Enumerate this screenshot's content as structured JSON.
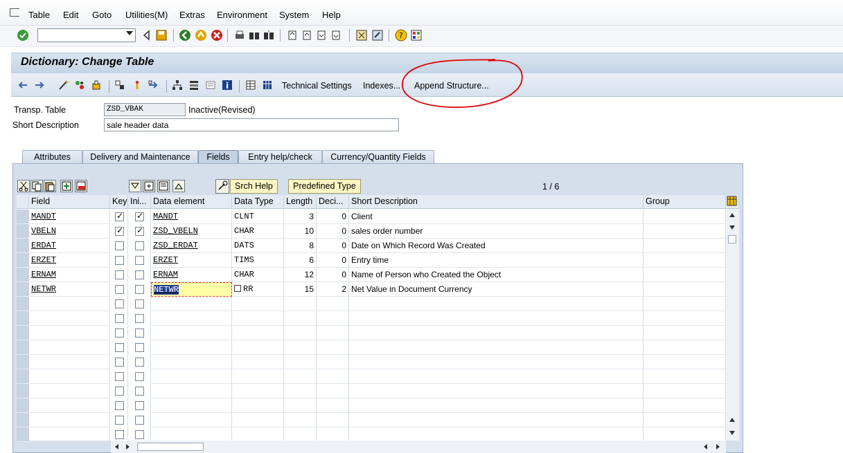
{
  "menu": [
    "Table",
    "Edit",
    "Goto",
    "Utilities(M)",
    "Extras",
    "Environment",
    "System",
    "Help"
  ],
  "title": "Dictionary: Change Table",
  "app_toolbar": {
    "technical_settings": "Technical Settings",
    "indexes": "Indexes...",
    "append_structure": "Append Structure..."
  },
  "header": {
    "table_label": "Transp. Table",
    "table_value": "ZSD_VBAK",
    "status": "Inactive(Revised)",
    "desc_label": "Short Description",
    "desc_value": "sale header data"
  },
  "tabs": [
    "Attributes",
    "Delivery and Maintenance",
    "Fields",
    "Entry help/check",
    "Currency/Quantity Fields"
  ],
  "buttons": {
    "srch_help": "Srch Help",
    "predefined_type": "Predefined Type",
    "page": "1 / 6"
  },
  "columns": [
    "Field",
    "Key",
    "Ini...",
    "Data element",
    "Data Type",
    "Length",
    "Deci...",
    "Short Description",
    "Group"
  ],
  "rows": [
    {
      "field": "MANDT",
      "key": true,
      "init": true,
      "element": "MANDT",
      "type": "CLNT",
      "length": "3",
      "dec": "0",
      "desc": "Client"
    },
    {
      "field": "VBELN",
      "key": true,
      "init": true,
      "element": "ZSD_VBELN",
      "type": "CHAR",
      "length": "10",
      "dec": "0",
      "desc": "sales order number"
    },
    {
      "field": "ERDAT",
      "key": false,
      "init": false,
      "element": "ZSD_ERDAT",
      "type": "DATS",
      "length": "8",
      "dec": "0",
      "desc": "Date on Which Record Was Created"
    },
    {
      "field": "ERZET",
      "key": false,
      "init": false,
      "element": "ERZET",
      "type": "TIMS",
      "length": "6",
      "dec": "0",
      "desc": "Entry time"
    },
    {
      "field": "ERNAM",
      "key": false,
      "init": false,
      "element": "ERNAM",
      "type": "CHAR",
      "length": "12",
      "dec": "0",
      "desc": "Name of Person who Created the Object"
    },
    {
      "field": "NETWR",
      "key": false,
      "init": false,
      "element": "NETWR",
      "type": "RR",
      "length": "15",
      "dec": "2",
      "desc": "Net Value in Document Currency"
    }
  ],
  "empty_rows": 10,
  "colors": {
    "title_bg": "#c4d4e6",
    "highlight": "#ffffa8",
    "annotation": "#e00000"
  }
}
